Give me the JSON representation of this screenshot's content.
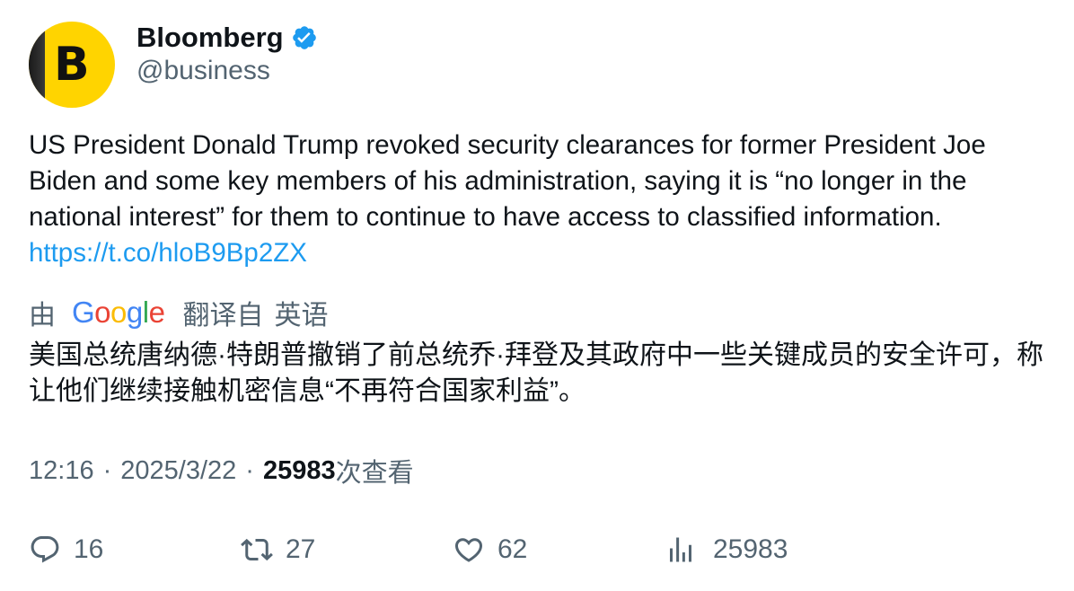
{
  "author": {
    "avatar_letter": "B",
    "display_name": "Bloomberg",
    "handle": "@business",
    "verified": true
  },
  "tweet": {
    "text": "US President Donald Trump revoked security clearances for former President Joe Biden and some key members of his administration, saying it is “no longer in the national interest” for them to continue to have access to classified information. ",
    "link": "https://t.co/hloB9Bp2ZX"
  },
  "translation": {
    "by_label": "由",
    "provider": "Google",
    "translated_from_label": "翻译自",
    "source_language": "英语",
    "translated_text": "美国总统唐纳德·特朗普撤销了前总统乔·拜登及其政府中一些关键成员的安全许可，称让他们继续接触机密信息“不再符合国家利益”。"
  },
  "meta": {
    "time": "12:16",
    "separator": "·",
    "date": "2025/3/22",
    "views_count": "25983",
    "views_label": "次查看"
  },
  "actions": {
    "replies": "16",
    "retweets": "27",
    "likes": "62",
    "views": "25983"
  },
  "colors": {
    "text_primary": "#0f1419",
    "text_secondary": "#536471",
    "link": "#1d9bf0",
    "verified_badge": "#1d9bf0",
    "avatar_bg": "#ffd400"
  },
  "icons": {
    "verified": "verified-badge-icon",
    "reply": "reply-icon",
    "retweet": "retweet-icon",
    "like": "heart-icon",
    "views": "views-chart-icon"
  }
}
